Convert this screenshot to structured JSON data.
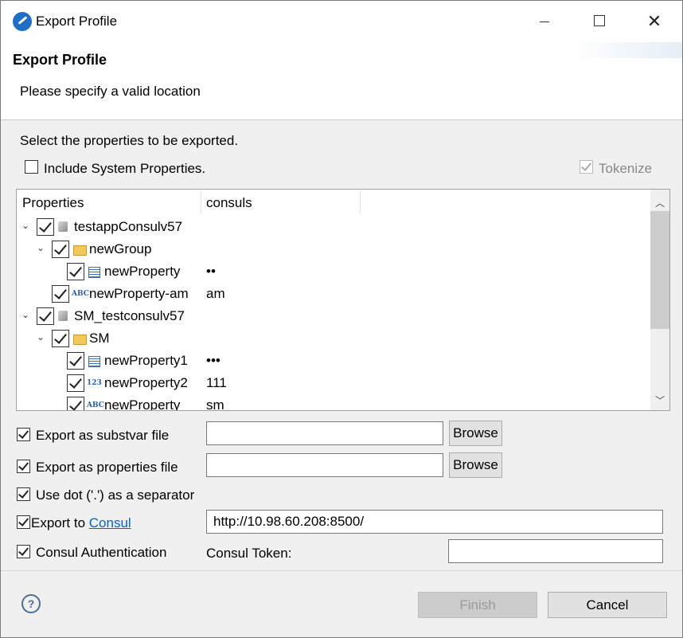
{
  "window": {
    "title": "Export Profile"
  },
  "header": {
    "title": "Export Profile",
    "message": "Please specify a valid location"
  },
  "content": {
    "instruction": "Select the properties to be exported.",
    "include_system_label": "Include System Properties.",
    "tokenize_label": "Tokenize"
  },
  "tree": {
    "columns": [
      "Properties",
      "consuls"
    ],
    "rows": [
      {
        "label": "testappConsulv57",
        "value": "",
        "icon": "project-icon"
      },
      {
        "label": "newGroup",
        "value": "",
        "icon": "folder-icon"
      },
      {
        "label": "newProperty",
        "value": "••",
        "icon": "table-icon"
      },
      {
        "label": "newProperty-am",
        "value": "am",
        "icon": "abc-icon",
        "icon_text": "ABC"
      },
      {
        "label": "SM_testconsulv57",
        "value": "",
        "icon": "project-icon"
      },
      {
        "label": "SM",
        "value": "",
        "icon": "folder-icon"
      },
      {
        "label": "newProperty1",
        "value": "•••",
        "icon": "table-icon"
      },
      {
        "label": "newProperty2",
        "value": "111",
        "icon": "number-icon",
        "icon_text": "123"
      },
      {
        "label": "newProperty",
        "value": "sm",
        "icon": "abc-icon",
        "icon_text": "ABC"
      }
    ]
  },
  "options": {
    "substvar_label": "Export as substvar file",
    "substvar_value": "",
    "properties_label": "Export as properties file",
    "properties_value": "",
    "browse_label": "Browse",
    "dot_separator_label": "Use dot ('.') as a separator",
    "export_to_label": "Export to ",
    "consul_link": "Consul",
    "consul_url": "http://10.98.60.208:8500/",
    "auth_label": "Consul Authentication",
    "token_label": "Consul Token:",
    "token_value": ""
  },
  "footer": {
    "help": "?",
    "finish_label": "Finish",
    "cancel_label": "Cancel"
  }
}
